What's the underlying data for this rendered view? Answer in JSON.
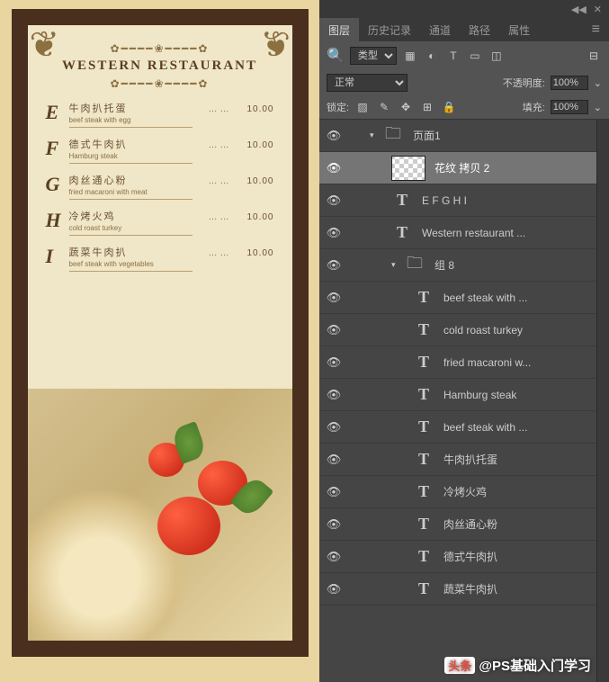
{
  "canvas": {
    "title": "WESTERN RESTAURANT",
    "items": [
      {
        "letter": "E",
        "cn": "牛肉扒托蛋",
        "en": "beef steak with egg",
        "price": "10.00"
      },
      {
        "letter": "F",
        "cn": "德式牛肉扒",
        "en": "Hamburg steak",
        "price": "10.00"
      },
      {
        "letter": "G",
        "cn": "肉丝通心粉",
        "en": "fried macaroni with meat",
        "price": "10.00"
      },
      {
        "letter": "H",
        "cn": "冷烤火鸡",
        "en": "cold roast turkey",
        "price": "10.00"
      },
      {
        "letter": "I",
        "cn": "蔬菜牛肉扒",
        "en": "beef steak with vegetables",
        "price": "10.00"
      }
    ]
  },
  "panel": {
    "tabs": [
      "图层",
      "历史记录",
      "通道",
      "路径",
      "属性"
    ],
    "filter_label": "类型",
    "blend_mode": "正常",
    "opacity_label": "不透明度:",
    "opacity_value": "100%",
    "lock_label": "锁定:",
    "fill_label": "填充:",
    "fill_value": "100%",
    "layers": [
      {
        "type": "folder",
        "name": "页面1",
        "indent": 1,
        "expanded": true
      },
      {
        "type": "pattern",
        "name": "花纹 拷贝 2",
        "indent": 2,
        "selected": true
      },
      {
        "type": "text",
        "name": "E F G H I",
        "indent": 2
      },
      {
        "type": "text",
        "name": "Western restaurant ...",
        "indent": 2
      },
      {
        "type": "folder",
        "name": "组 8",
        "indent": 2,
        "expanded": true
      },
      {
        "type": "text",
        "name": "beef steak with ...",
        "indent": 3
      },
      {
        "type": "text",
        "name": "cold roast turkey",
        "indent": 3
      },
      {
        "type": "text",
        "name": "fried macaroni w...",
        "indent": 3
      },
      {
        "type": "text",
        "name": "Hamburg steak",
        "indent": 3
      },
      {
        "type": "text",
        "name": "beef steak with ...",
        "indent": 3
      },
      {
        "type": "text",
        "name": "牛肉扒托蛋",
        "indent": 3
      },
      {
        "type": "text",
        "name": "冷烤火鸡",
        "indent": 3
      },
      {
        "type": "text",
        "name": "肉丝通心粉",
        "indent": 3
      },
      {
        "type": "text",
        "name": "德式牛肉扒",
        "indent": 3
      },
      {
        "type": "text",
        "name": "蔬菜牛肉扒",
        "indent": 3
      }
    ]
  },
  "watermark": {
    "icon": "头条",
    "text": "@PS基础入门学习"
  }
}
